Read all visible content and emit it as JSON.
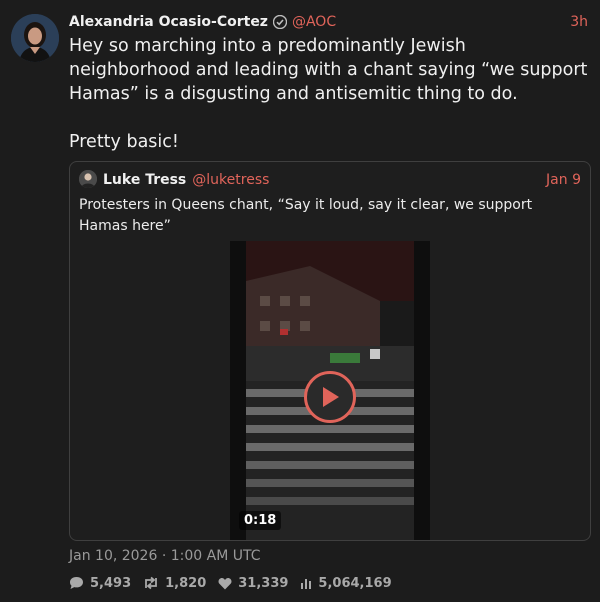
{
  "post": {
    "author_name": "Alexandria Ocasio-Cortez",
    "author_handle": "@AOC",
    "relative_time": "3h",
    "text": "Hey so marching into a predominantly Jewish neighborhood and leading with a chant saying “we support Hamas” is a disgusting and antisemitic thing to do.\n\nPretty basic!",
    "timestamp": "Jan 10, 2026 · 1:00 AM UTC"
  },
  "quote": {
    "author_name": "Luke Tress",
    "author_handle": "@luketress",
    "date": "Jan 9",
    "text": "Protesters in Queens chant, “Say it loud, say it clear, we support Hamas here”",
    "video_duration": "0:18"
  },
  "stats": {
    "replies": "5,493",
    "reposts": "1,820",
    "likes": "31,339",
    "views": "5,064,169"
  },
  "icons": {
    "verified": "verified-badge-icon",
    "reply": "speech-bubble-icon",
    "repost": "repost-arrows-icon",
    "like": "heart-icon",
    "views": "bar-chart-icon",
    "play": "play-icon"
  },
  "colors": {
    "accent": "#e0645a",
    "background": "#1c1c1c",
    "text": "#f0f0f0",
    "muted": "#9a9a9a"
  }
}
